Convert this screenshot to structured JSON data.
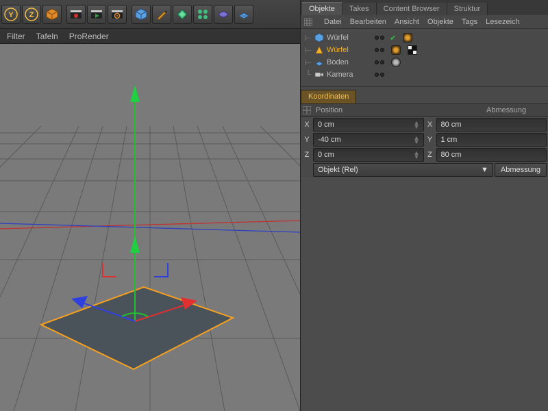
{
  "toolbar_icons": [
    "axis-y",
    "axis-z",
    "cube-orange",
    "clapper",
    "clapper-play",
    "clapper-gear",
    "prim-cube",
    "pen",
    "prim-capsule",
    "array",
    "deformer",
    "plane-grid"
  ],
  "left_menu": {
    "filter": "Filter",
    "tafeln": "Tafeln",
    "prorender": "ProRender"
  },
  "right_tabs": [
    "Objekte",
    "Takes",
    "Content Browser",
    "Struktur"
  ],
  "right_tabs_active": 0,
  "right_menu": [
    "Datei",
    "Bearbeiten",
    "Ansicht",
    "Objekte",
    "Tags",
    "Lesezeich"
  ],
  "tree": [
    {
      "name": "Würfel",
      "icon": "cube",
      "sel": false,
      "tags": [
        "gold"
      ]
    },
    {
      "name": "Würfel",
      "icon": "cone",
      "sel": true,
      "tags": [
        "gold",
        "chk"
      ]
    },
    {
      "name": "Boden",
      "icon": "floor",
      "sel": false,
      "tags": [
        "disc"
      ]
    },
    {
      "name": "Kamera",
      "icon": "camera",
      "sel": false,
      "tags": []
    }
  ],
  "coords": {
    "tab": "Koordinaten",
    "pos_label": "Position",
    "dim_label": "Abmessung",
    "rows": [
      {
        "axis": "X",
        "pos": "0 cm",
        "dim": "80 cm"
      },
      {
        "axis": "Y",
        "pos": "-40 cm",
        "dim": "1 cm"
      },
      {
        "axis": "Z",
        "pos": "0 cm",
        "dim": "80 cm"
      }
    ],
    "mode": "Objekt (Rel)",
    "btn": "Abmessung"
  }
}
